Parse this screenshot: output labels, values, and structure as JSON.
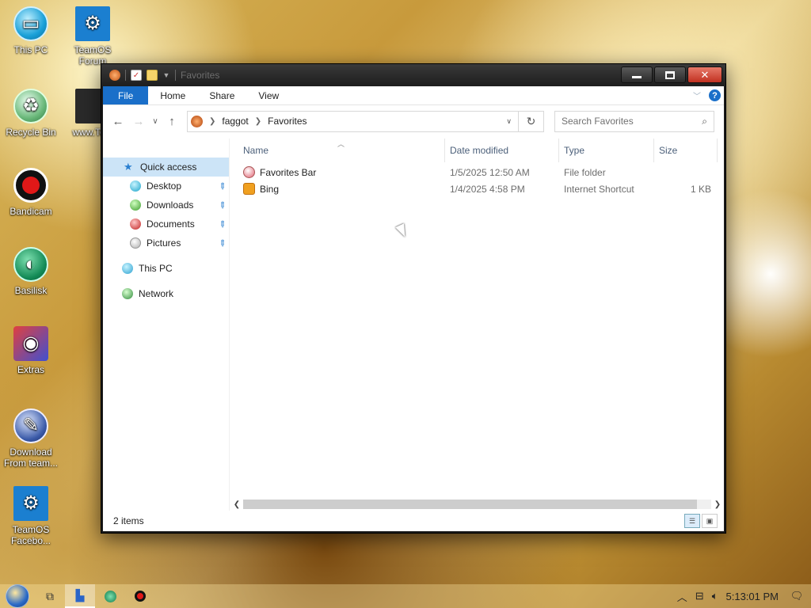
{
  "desktop": {
    "icons": [
      {
        "label": "This PC"
      },
      {
        "label": "TeamOS Forum"
      },
      {
        "label": "Recycle Bin"
      },
      {
        "label": "www.Te..."
      },
      {
        "label": "Bandicam"
      },
      {
        "label": "Basilisk"
      },
      {
        "label": "Extras"
      },
      {
        "label": "Download From team..."
      },
      {
        "label": "TeamOS Facebo..."
      }
    ]
  },
  "window": {
    "title": "Favorites",
    "ribbon": {
      "tabs": [
        "File",
        "Home",
        "Share",
        "View"
      ],
      "help": "?"
    },
    "address": {
      "crumbs": [
        "faggot",
        "Favorites"
      ]
    },
    "search": {
      "placeholder": "Search Favorites"
    },
    "nav": {
      "quick_access": "Quick access",
      "pinned": [
        "Desktop",
        "Downloads",
        "Documents",
        "Pictures"
      ],
      "this_pc": "This PC",
      "network": "Network"
    },
    "columns": {
      "name": "Name",
      "date": "Date modified",
      "type": "Type",
      "size": "Size"
    },
    "files": [
      {
        "name": "Favorites Bar",
        "date": "1/5/2025 12:50 AM",
        "type": "File folder",
        "size": "",
        "icon": "favorites-bar-icon"
      },
      {
        "name": "Bing",
        "date": "1/4/2025 4:58 PM",
        "type": "Internet Shortcut",
        "size": "1 KB",
        "icon": "internet-shortcut-icon"
      }
    ],
    "status": {
      "items": "2 items"
    }
  },
  "taskbar": {
    "clock": "5:13:01 PM"
  }
}
